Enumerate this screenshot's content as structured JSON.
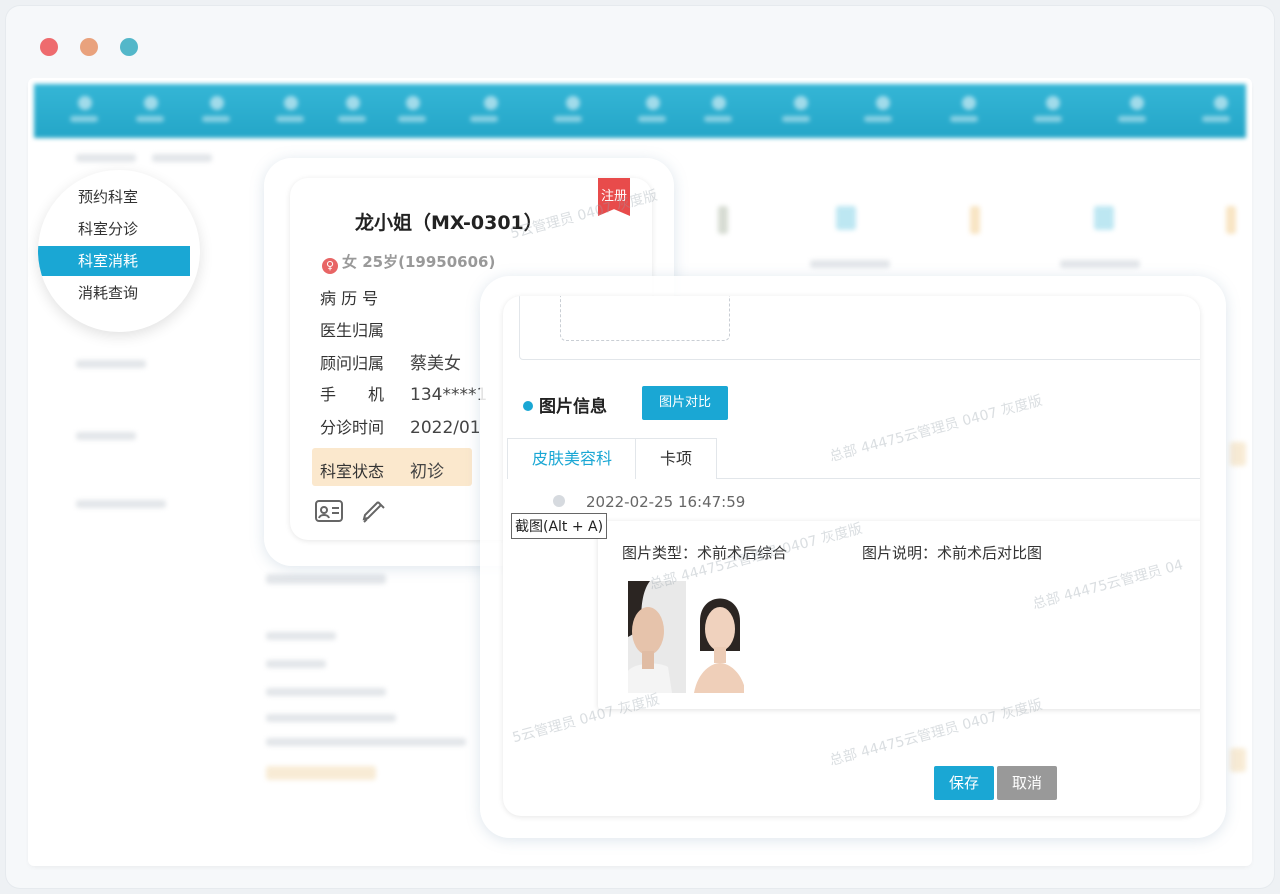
{
  "window_controls": [
    "close",
    "minimize",
    "maximize"
  ],
  "menu": {
    "items": [
      "预约科室",
      "科室分诊",
      "科室消耗",
      "消耗查询"
    ],
    "active_index": 2
  },
  "patient_card": {
    "title": "龙小姐（MX-0301）",
    "ribbon": "注册",
    "gender_icon": "female-icon",
    "gender_age": "女 25岁(19950606)",
    "fields": [
      {
        "label": "病 历 号",
        "value": ""
      },
      {
        "label": "医生归属",
        "value": ""
      },
      {
        "label": "顾问归属",
        "value": "蔡美女"
      },
      {
        "label": "手　　机",
        "value": "134****1"
      },
      {
        "label": "分诊时间",
        "value": "2022/01"
      },
      {
        "label": "科室状态",
        "value": "初诊"
      }
    ],
    "action_icons": [
      "id-card-icon",
      "syringe-icon"
    ]
  },
  "image_dialog": {
    "section_title": "图片信息",
    "compare_button": "图片对比",
    "tabs": [
      "皮肤美容科",
      "卡项"
    ],
    "active_tab": 0,
    "timeline_date": "2022-02-25 16:47:59",
    "screenshot_tip": "截图(Alt + A)",
    "image_type_label": "图片类型：",
    "image_type_value": "术前术后综合",
    "image_desc_label": "图片说明：",
    "image_desc_value": "术前术后对比图",
    "save_button": "保存",
    "cancel_button": "取消"
  },
  "watermarks": [
    "5云管理员 0407 灰度版",
    "总部 44475云管理员 0407 灰度版",
    "总部 44475云管理员 04"
  ],
  "colors": {
    "accent": "#1aa7d4",
    "ribbon": "#e84b4b",
    "status_bg": "#fbe8cd"
  }
}
